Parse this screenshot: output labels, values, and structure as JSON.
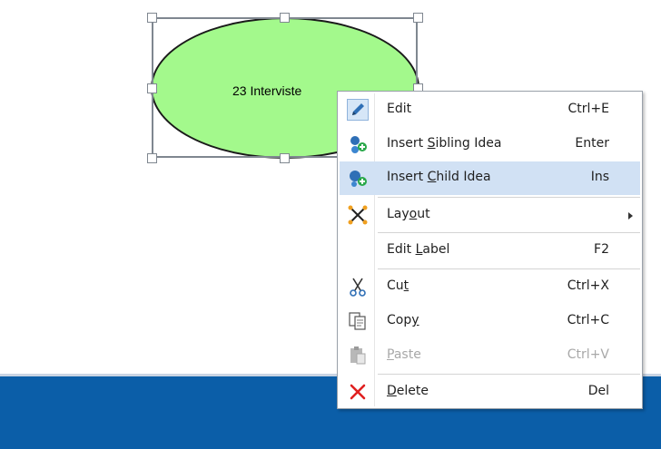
{
  "canvas": {
    "node": {
      "label": "23 Interviste",
      "fill_color": "#a3f98c"
    }
  },
  "context_menu": {
    "items": [
      {
        "label_pre": "Edit",
        "label_u": "",
        "label_post": "",
        "shortcut": "Ctrl+E",
        "icon": "pencil-icon"
      },
      {
        "label_pre": "Insert ",
        "label_u": "S",
        "label_post": "ibling Idea",
        "shortcut": "Enter",
        "icon": "insert-sibling-icon"
      },
      {
        "label_pre": "Insert ",
        "label_u": "C",
        "label_post": "hild Idea",
        "shortcut": "Ins",
        "icon": "insert-child-icon",
        "highlighted": true
      },
      {
        "label_pre": "Lay",
        "label_u": "o",
        "label_post": "ut",
        "shortcut": "",
        "icon": "layout-icon",
        "submenu": true
      },
      {
        "label_pre": "Edit ",
        "label_u": "L",
        "label_post": "abel",
        "shortcut": "F2",
        "icon": ""
      },
      {
        "label_pre": "Cu",
        "label_u": "t",
        "label_post": "",
        "shortcut": "Ctrl+X",
        "icon": "scissors-icon"
      },
      {
        "label_pre": "Cop",
        "label_u": "y",
        "label_post": "",
        "shortcut": "Ctrl+C",
        "icon": "copy-icon"
      },
      {
        "label_pre": "",
        "label_u": "P",
        "label_post": "aste",
        "shortcut": "Ctrl+V",
        "icon": "paste-icon",
        "disabled": true
      },
      {
        "label_pre": "",
        "label_u": "D",
        "label_post": "elete",
        "shortcut": "Del",
        "icon": "delete-icon"
      }
    ]
  },
  "colors": {
    "status_bar": "#0b5ea8",
    "highlight": "#d1e1f4",
    "delete_red": "#e02020"
  }
}
